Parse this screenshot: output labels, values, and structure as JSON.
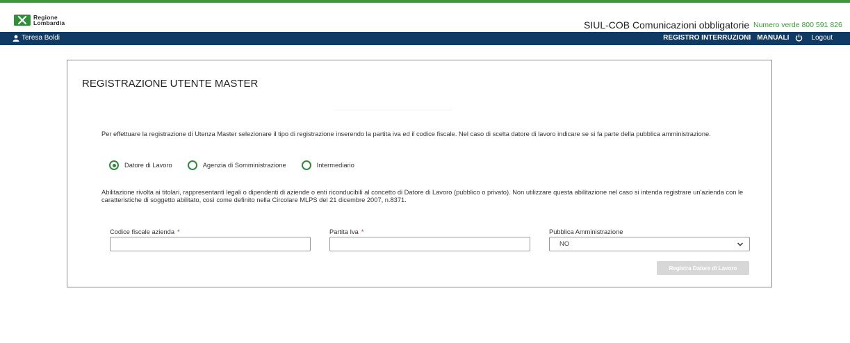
{
  "header": {
    "logo_line1": "Regione",
    "logo_line2": "Lombardia",
    "app_title_main": "SIUL-COB",
    "app_title_sub": "Comunicazioni obbligatorie",
    "phone": "Numero verde 800 591 826"
  },
  "navbar": {
    "user_name": "Teresa Boldi",
    "link_registro": "REGISTRO INTERRUZIONI",
    "link_manuali": "MANUALI",
    "link_logout": "Logout"
  },
  "form": {
    "title": "REGISTRAZIONE UTENTE MASTER",
    "intro": "Per effettuare la registrazione di Utenza Master selezionare il tipo di registrazione inserendo la partita iva ed il codice fiscale. Nel caso di scelta datore di lavoro indicare se si fa parte della pubblica amministrazione.",
    "radio_options": [
      "Datore di Lavoro",
      "Agenzia di Somministrazione",
      "Intermediario"
    ],
    "selected_option": "Datore di Lavoro",
    "description": "Abilitazione rivolta ai titolari, rappresentanti legali o dipendenti di aziende o enti riconducibili al concetto di Datore di Lavoro (pubblico o privato). Non utilizzare questa abilitazione nel caso si intenda registrare un'azienda con le caratteristiche di soggetto abilitato, così come definito nella Circolare MLPS del 21 dicembre 2007, n.8371.",
    "codice_fiscale_label": "Codice fiscale azienda",
    "codice_fiscale_value": "",
    "partita_iva_label": "Partita Iva",
    "partita_iva_value": "",
    "required_mark": "*",
    "pa_label": "Pubblica Amministrazione",
    "pa_value": "NO",
    "submit_label": "Registra Datore di Lavoro"
  },
  "colors": {
    "brand_green": "#3d9a3b",
    "navbar_blue": "#0f3a64",
    "required_red": "#d32f2f",
    "disabled_button": "#d7d7d7"
  }
}
